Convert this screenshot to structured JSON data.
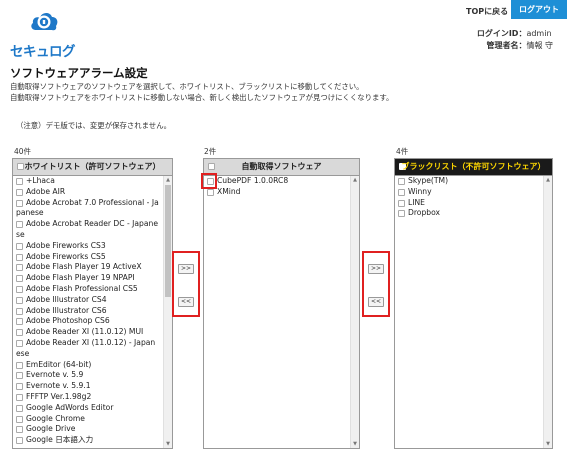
{
  "brand": {
    "name": "セキュログ"
  },
  "header": {
    "top_link": "TOPに戻る",
    "logout": "ログアウト",
    "login_id_label": "ログインID：",
    "login_id": "admin",
    "admin_name_label": "管理者名：",
    "admin_name": "情報 守"
  },
  "page": {
    "title": "ソフトウェアアラーム設定",
    "desc_line1": "自動取得ソフトウェアのソフトウェアを選択して、ホワイトリスト、ブラックリストに移動してください。",
    "desc_line2": "自動取得ソフトウェアをホワイトリストに移動しない場合、新しく検出したソフトウェアが見つけにくくなります。",
    "note": "（注意）デモ版では、変更が保存されません。"
  },
  "whitelist": {
    "count": "40件",
    "title": "ホワイトリスト（許可ソフトウェア）",
    "items": [
      "+Lhaca",
      "Adobe AIR",
      "Adobe Acrobat 7.0 Professional - Ja",
      "panese",
      "Adobe Acrobat Reader DC - Japane",
      "se",
      "Adobe Fireworks CS3",
      "Adobe Fireworks CS5",
      "Adobe Flash Player 19 ActiveX",
      "Adobe Flash Player 19 NPAPI",
      "Adobe Flash Professional CS5",
      "Adobe Illustrator CS4",
      "Adobe Illustrator CS6",
      "Adobe Photoshop CS6",
      "Adobe Reader XI (11.0.12) MUI",
      "Adobe Reader XI (11.0.12) - Japan",
      "ese",
      "EmEditor (64-bit)",
      "Evernote v. 5.9",
      "Evernote v. 5.9.1",
      "FFFTP Ver.1.98g2",
      "Google AdWords Editor",
      "Google Chrome",
      "Google Drive",
      "Google 日本語入力"
    ],
    "checkbox_rows": [
      true,
      true,
      true,
      false,
      true,
      false,
      true,
      true,
      true,
      true,
      true,
      true,
      true,
      true,
      true,
      true,
      false,
      true,
      true,
      true,
      true,
      true,
      true,
      true,
      true
    ]
  },
  "auto": {
    "count": "2件",
    "title": "自動取得ソフトウェア",
    "items": [
      "CubePDF 1.0.0RC8",
      "XMind"
    ]
  },
  "blacklist": {
    "count": "4件",
    "title": "ブラックリスト（不許可ソフトウェア）",
    "items": [
      "Skype(TM)",
      "Winny",
      "LINE",
      "Dropbox"
    ]
  },
  "buttons": {
    "move_right": ">>",
    "move_left": "<<"
  },
  "colors": {
    "accent": "#1e8fd6",
    "brand": "#1e78c8",
    "highlight": "#e02020",
    "blacklist_header_bg": "#1a1a1a",
    "blacklist_header_text": "#ffd800"
  }
}
